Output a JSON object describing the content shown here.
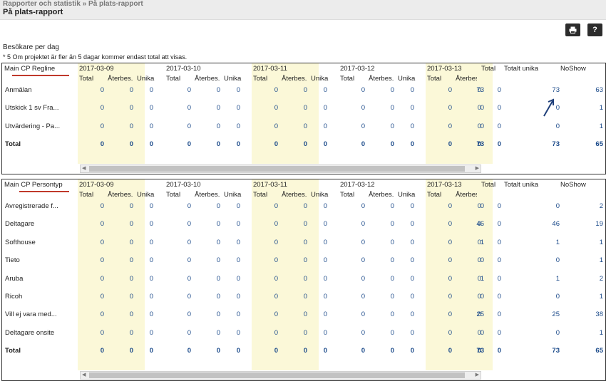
{
  "header": {
    "breadcrumb": "Rapporter och statistik » På plats-rapport",
    "title": "På plats-rapport"
  },
  "toolbar": {
    "print_icon": "printer-icon",
    "help_label": "?"
  },
  "intro": {
    "subtitle": "Besökare per dag",
    "note": "* 5 Om projektet är fler än 5 dagar kommer endast total att visas."
  },
  "columns": {
    "dates": [
      "2017-03-09",
      "2017-03-10",
      "2017-03-11",
      "2017-03-12",
      "2017-03-13"
    ],
    "sub": [
      "Total",
      "Återbes.",
      "Unika"
    ],
    "total": "Total",
    "total_unique": "Totalt unika",
    "noshow": "NoShow"
  },
  "tables": [
    {
      "group_prefix": "Main CP ",
      "group_name": "Regline",
      "rows": [
        {
          "label": "Anmälan",
          "values": [
            "0",
            "0",
            "0",
            "0",
            "0",
            "0",
            "0",
            "0",
            "0",
            "0",
            "0",
            "0",
            "0",
            "0",
            "0"
          ],
          "total": "73",
          "unique": "73",
          "noshow": "63"
        },
        {
          "label": "Utskick 1 sv Fra...",
          "values": [
            "0",
            "0",
            "0",
            "0",
            "0",
            "0",
            "0",
            "0",
            "0",
            "0",
            "0",
            "0",
            "0",
            "0",
            "0"
          ],
          "total": "0",
          "unique": "0",
          "noshow": "1"
        },
        {
          "label": "Utvärdering - Pa...",
          "values": [
            "0",
            "0",
            "0",
            "0",
            "0",
            "0",
            "0",
            "0",
            "0",
            "0",
            "0",
            "0",
            "0",
            "0",
            "0"
          ],
          "total": "0",
          "unique": "0",
          "noshow": "1"
        },
        {
          "label": "Total",
          "bold": true,
          "values": [
            "0",
            "0",
            "0",
            "0",
            "0",
            "0",
            "0",
            "0",
            "0",
            "0",
            "0",
            "0",
            "0",
            "0",
            "0"
          ],
          "total": "73",
          "unique": "73",
          "noshow": "65"
        }
      ]
    },
    {
      "group_prefix": "Main CP ",
      "group_name": "Persontyp",
      "rows": [
        {
          "label": "Avregistrerade f...",
          "values": [
            "0",
            "0",
            "0",
            "0",
            "0",
            "0",
            "0",
            "0",
            "0",
            "0",
            "0",
            "0",
            "0",
            "0",
            "0"
          ],
          "total": "0",
          "unique": "0",
          "noshow": "2"
        },
        {
          "label": "Deltagare",
          "values": [
            "0",
            "0",
            "0",
            "0",
            "0",
            "0",
            "0",
            "0",
            "0",
            "0",
            "0",
            "0",
            "0",
            "0",
            "0"
          ],
          "total": "46",
          "unique": "46",
          "noshow": "19"
        },
        {
          "label": "Softhouse",
          "values": [
            "0",
            "0",
            "0",
            "0",
            "0",
            "0",
            "0",
            "0",
            "0",
            "0",
            "0",
            "0",
            "0",
            "0",
            "0"
          ],
          "total": "1",
          "unique": "1",
          "noshow": "1"
        },
        {
          "label": "Tieto",
          "values": [
            "0",
            "0",
            "0",
            "0",
            "0",
            "0",
            "0",
            "0",
            "0",
            "0",
            "0",
            "0",
            "0",
            "0",
            "0"
          ],
          "total": "0",
          "unique": "0",
          "noshow": "1"
        },
        {
          "label": "Aruba",
          "values": [
            "0",
            "0",
            "0",
            "0",
            "0",
            "0",
            "0",
            "0",
            "0",
            "0",
            "0",
            "0",
            "0",
            "0",
            "0"
          ],
          "total": "1",
          "unique": "1",
          "noshow": "2"
        },
        {
          "label": "Ricoh",
          "values": [
            "0",
            "0",
            "0",
            "0",
            "0",
            "0",
            "0",
            "0",
            "0",
            "0",
            "0",
            "0",
            "0",
            "0",
            "0"
          ],
          "total": "0",
          "unique": "0",
          "noshow": "1"
        },
        {
          "label": "Vill ej vara med...",
          "values": [
            "0",
            "0",
            "0",
            "0",
            "0",
            "0",
            "0",
            "0",
            "0",
            "0",
            "0",
            "0",
            "0",
            "0",
            "0"
          ],
          "total": "25",
          "unique": "25",
          "noshow": "38"
        },
        {
          "label": "Deltagare onsite",
          "values": [
            "0",
            "0",
            "0",
            "0",
            "0",
            "0",
            "0",
            "0",
            "0",
            "0",
            "0",
            "0",
            "0",
            "0",
            "0"
          ],
          "total": "0",
          "unique": "0",
          "noshow": "1"
        },
        {
          "label": "Total",
          "bold": true,
          "values": [
            "0",
            "0",
            "0",
            "0",
            "0",
            "0",
            "0",
            "0",
            "0",
            "0",
            "0",
            "0",
            "0",
            "0",
            "0"
          ],
          "total": "73",
          "unique": "73",
          "noshow": "65"
        }
      ]
    }
  ],
  "colors": {
    "date_band": "#fbf8d8",
    "underline": "#c0392b",
    "annotation_arrow": "#1f3f7a"
  }
}
